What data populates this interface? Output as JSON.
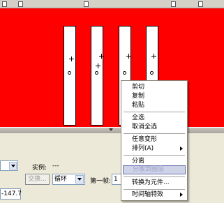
{
  "stage": {
    "background_color": "#ff0000",
    "bar_color": "#ffffff"
  },
  "props": {
    "instance_label": "实例:",
    "instance_value": "---",
    "swap_button": "交换...",
    "loop_select": "循环",
    "first_frame_label": "第一帧:",
    "first_frame_value": "1",
    "coordinate_value": "-147.7"
  },
  "context_menu": {
    "items": [
      {
        "label": "剪切"
      },
      {
        "label": "复制"
      },
      {
        "label": "粘贴"
      },
      {
        "label": "全选"
      },
      {
        "label": "取消全选"
      },
      {
        "label": "任意变形"
      },
      {
        "label": "排列(A)"
      },
      {
        "label": "分离"
      },
      {
        "label": "分散到图层"
      },
      {
        "label": "转换为元件..."
      },
      {
        "label": "时间轴特效"
      }
    ],
    "highlight_color": "#cfd3e8"
  }
}
